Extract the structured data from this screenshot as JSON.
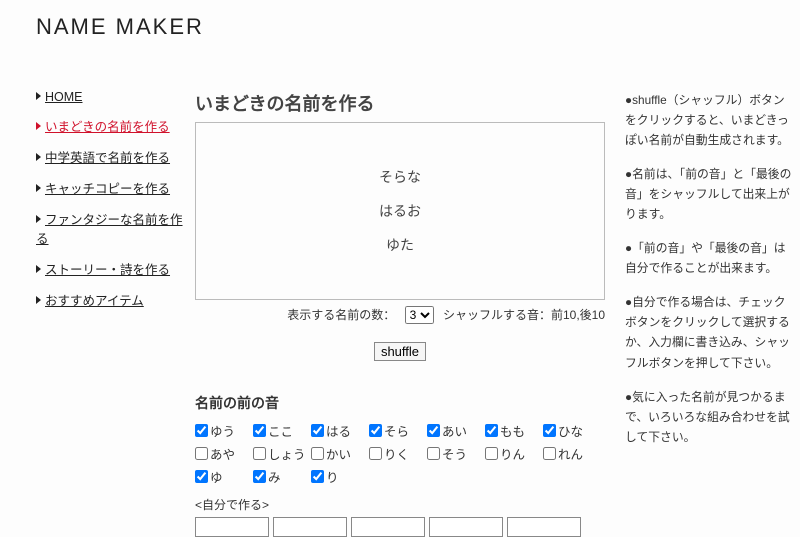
{
  "site_title": "NAME MAKER",
  "sidebar": {
    "items": [
      {
        "label": "HOME",
        "active": false
      },
      {
        "label": "いまどきの名前を作る",
        "active": true
      },
      {
        "label": "中学英語で名前を作る",
        "active": false
      },
      {
        "label": "キャッチコピーを作る",
        "active": false
      },
      {
        "label": "ファンタジーな名前を作る",
        "active": false
      },
      {
        "label": "ストーリー・詩を作る",
        "active": false
      },
      {
        "label": "おすすめアイテム",
        "active": false
      }
    ]
  },
  "main": {
    "heading": "いまどきの名前を作る",
    "generated_names": [
      "そらな",
      "はるお",
      "ゆた"
    ],
    "count_label": "表示する名前の数：",
    "count_value": "3",
    "shuffle_info": "シャッフルする音：前10,後10",
    "shuffle_button": "shuffle",
    "front_heading": "名前の前の音",
    "front_sounds": [
      {
        "label": "ゆう",
        "checked": true
      },
      {
        "label": "ここ",
        "checked": true
      },
      {
        "label": "はる",
        "checked": true
      },
      {
        "label": "そら",
        "checked": true
      },
      {
        "label": "あい",
        "checked": true
      },
      {
        "label": "もも",
        "checked": true
      },
      {
        "label": "ひな",
        "checked": true
      },
      {
        "label": "あや",
        "checked": false
      },
      {
        "label": "しょう",
        "checked": false
      },
      {
        "label": "かい",
        "checked": false
      },
      {
        "label": "りく",
        "checked": false
      },
      {
        "label": "そう",
        "checked": false
      },
      {
        "label": "りん",
        "checked": false
      },
      {
        "label": "れん",
        "checked": false
      },
      {
        "label": "ゆ",
        "checked": true
      },
      {
        "label": "み",
        "checked": true
      },
      {
        "label": "り",
        "checked": true
      }
    ],
    "custom_label": "<自分で作る>",
    "custom_count": 5
  },
  "aside": {
    "paras": [
      "●shuffle（シャッフル）ボタンをクリックすると、いまどきっぽい名前が自動生成されます。",
      "●名前は、「前の音」と「最後の音」をシャッフルして出来上がります。",
      "●「前の音」や「最後の音」は自分で作ることが出来ます。",
      "●自分で作る場合は、チェックボタンをクリックして選択するか、入力欄に書き込み、シャッフルボタンを押して下さい。",
      "●気に入った名前が見つかるまで、いろいろな組み合わせを試して下さい。"
    ]
  }
}
